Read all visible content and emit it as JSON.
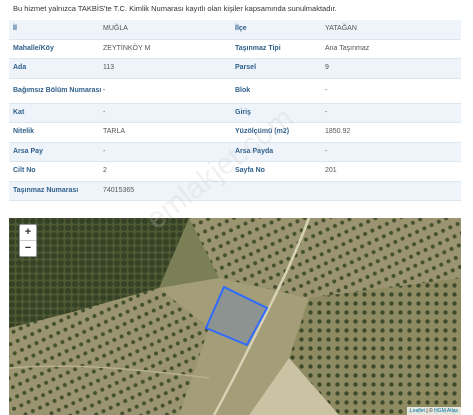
{
  "notice": "Bu hizmet yalnızca TAKBİS'te T.C. Kimlik Numarası kayıtlı olan kişiler kapsamında sunulmaktadır.",
  "rows": [
    {
      "l1": "İl",
      "v1": "MUĞLA",
      "l2": "İlçe",
      "v2": "YATAĞAN"
    },
    {
      "l1": "Mahalle/Köy",
      "v1": "ZEYTİNKÖY M",
      "l2": "Taşınmaz Tipi",
      "v2": "Ana Taşınmaz"
    },
    {
      "l1": "Ada",
      "v1": "113",
      "l2": "Parsel",
      "v2": "9"
    },
    {
      "l1": "Bağımsız Bölüm Numarası",
      "v1": "-",
      "l2": "Blok",
      "v2": "-"
    },
    {
      "l1": "Kat",
      "v1": "-",
      "l2": "Giriş",
      "v2": "-"
    },
    {
      "l1": "Nitelik",
      "v1": "TARLA",
      "l2": "Yüzölçümü (m2)",
      "v2": "1850.92"
    },
    {
      "l1": "Arsa Pay",
      "v1": "-",
      "l2": "Arsa Payda",
      "v2": "-"
    },
    {
      "l1": "Cilt No",
      "v1": "2",
      "l2": "Sayfa No",
      "v2": "201"
    },
    {
      "l1": "Taşınmaz Numarası",
      "v1": "74015365",
      "l2": "",
      "v2": ""
    }
  ],
  "map": {
    "zoom_in": "+",
    "zoom_out": "−",
    "attr_leaflet": "Leaflet",
    "attr_sep": " | © ",
    "attr_source": "HGM Atlas"
  },
  "watermark": "emlakjet.com",
  "colors": {
    "label": "#2f5f8a",
    "row_alt": "#eef4fa",
    "parcel": "#2f6bff"
  }
}
